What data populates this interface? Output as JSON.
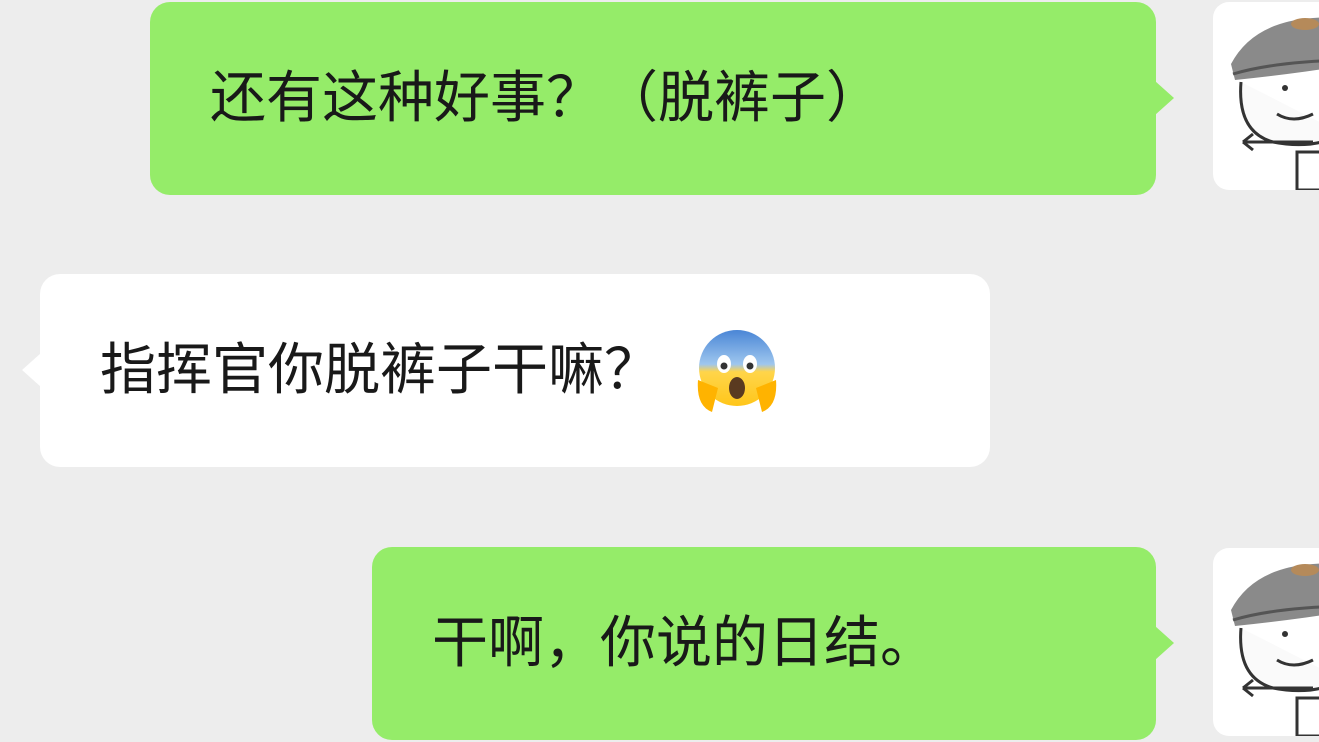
{
  "messages": [
    {
      "id": "msg1",
      "side": "outgoing",
      "text": "还有这种好事？（脱裤子）"
    },
    {
      "id": "msg2",
      "side": "incoming",
      "text": "指挥官你脱裤子干嘛？",
      "emoji": "face-screaming-in-fear"
    },
    {
      "id": "msg3",
      "side": "outgoing",
      "text": "干啊，你说的日结。"
    }
  ],
  "avatars": {
    "self": "cartoon-officer-avatar"
  },
  "colors": {
    "background": "#ededed",
    "outgoing_bubble": "#95ec69",
    "incoming_bubble": "#ffffff",
    "text": "#191919"
  }
}
